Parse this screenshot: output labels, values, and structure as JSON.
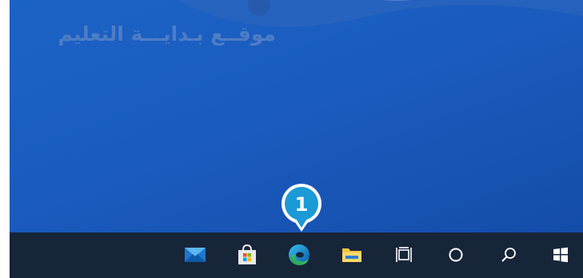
{
  "watermark": {
    "text": "موقــع بـدايـــة التعليم"
  },
  "callout": {
    "number": "1",
    "color": "#1b9ad6"
  },
  "colors": {
    "desktop": "#1a5bbd",
    "taskbar": "#172539"
  },
  "taskbar": {
    "items": [
      {
        "name": "mail",
        "icon": "mail-icon"
      },
      {
        "name": "store",
        "icon": "microsoft-store-icon"
      },
      {
        "name": "edge",
        "icon": "edge-icon"
      },
      {
        "name": "file-explorer",
        "icon": "folder-icon"
      },
      {
        "name": "task-view",
        "icon": "task-view-icon"
      },
      {
        "name": "cortana",
        "icon": "cortana-icon"
      },
      {
        "name": "search",
        "icon": "search-icon"
      },
      {
        "name": "start",
        "icon": "windows-start-icon"
      }
    ]
  }
}
